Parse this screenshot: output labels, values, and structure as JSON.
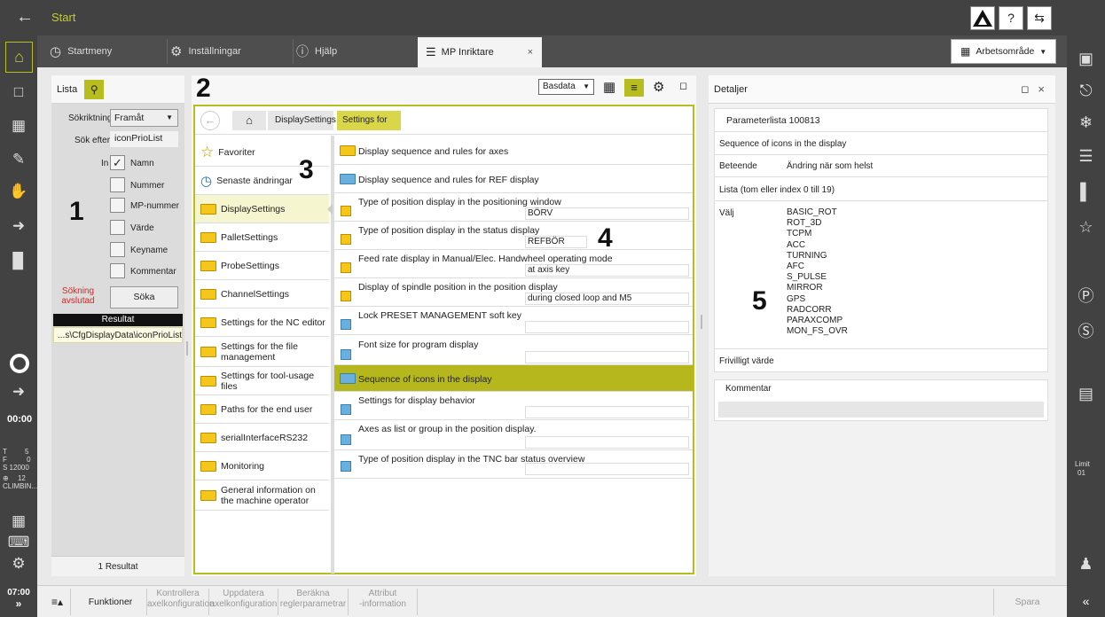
{
  "app": {
    "title": "Start",
    "time_clock": "00:00",
    "time_bottom": "07:00"
  },
  "tabs": [
    {
      "label": "Startmeny"
    },
    {
      "label": "Inställningar"
    },
    {
      "label": "Hjälp"
    },
    {
      "label": "MP Inriktare"
    }
  ],
  "workspace": {
    "label": "Arbetsområde"
  },
  "status": {
    "t": "T",
    "t_val": "5",
    "f": "F",
    "f_val": "0",
    "s": "S 12000",
    "tool_num": "12",
    "tool_name": "CLIMBIN...",
    "limit": "Limit",
    "limit_val": "01"
  },
  "list_panel": {
    "title": "Lista",
    "direction_label": "Sökriktning",
    "direction_value": "Framåt",
    "search_label": "Sök efter",
    "search_value": "iconPrioList",
    "in_label": "In",
    "checkboxes": [
      {
        "label": "Namn",
        "checked": true
      },
      {
        "label": "Nummer",
        "checked": false
      },
      {
        "label": "MP-nummer",
        "checked": false
      },
      {
        "label": "Värde",
        "checked": false
      },
      {
        "label": "Keyname",
        "checked": false
      },
      {
        "label": "Kommentar",
        "checked": false
      }
    ],
    "status_line1": "Sökning",
    "status_line2": "avslutad",
    "search_button": "Söka",
    "result_header": "Resultat",
    "result_item": "...s\\CfgDisplayData\\iconPrioList",
    "result_count": "1 Resultat"
  },
  "center": {
    "view_select": "Basdata",
    "breadcrumb": [
      "DisplaySettings",
      "Settings for sc..."
    ],
    "nav": [
      {
        "label": "Favoriter",
        "icon": "star-icon"
      },
      {
        "label": "Senaste ändringar",
        "icon": "clock-icon"
      },
      {
        "label": "DisplaySettings",
        "icon": "folder-icon"
      },
      {
        "label": "PalletSettings",
        "icon": "folder-icon"
      },
      {
        "label": "ProbeSettings",
        "icon": "folder-icon"
      },
      {
        "label": "ChannelSettings",
        "icon": "folder-icon"
      },
      {
        "label": "Settings for the NC editor",
        "icon": "folder-icon"
      },
      {
        "label": "Settings for the file management",
        "icon": "folder-icon"
      },
      {
        "label": "Settings for tool-usage files",
        "icon": "folder-icon"
      },
      {
        "label": "Paths for the end user",
        "icon": "folder-icon"
      },
      {
        "label": "serialInterfaceRS232",
        "icon": "folder-icon"
      },
      {
        "label": "Monitoring",
        "icon": "folder-icon"
      },
      {
        "label": "General information on the machine operator",
        "icon": "folder-icon"
      }
    ],
    "params": [
      {
        "label": "Display sequence and rules for axes",
        "value": ""
      },
      {
        "label": "Display sequence and rules for REF display",
        "value": ""
      },
      {
        "label": "Type of position display in the positioning window",
        "value": "BÖRV"
      },
      {
        "label": "Type of position display in the status display",
        "value": "REFBÖR"
      },
      {
        "label": "Feed rate display in Manual/Elec. Handwheel operating mode",
        "value": "at axis key"
      },
      {
        "label": "Display of spindle position in the position display",
        "value": "during closed loop and M5"
      },
      {
        "label": "Lock PRESET MANAGEMENT soft key",
        "value": ""
      },
      {
        "label": "Font size for program display",
        "value": ""
      },
      {
        "label": "Sequence of icons in the display",
        "value": ""
      },
      {
        "label": "Settings for display behavior",
        "value": ""
      },
      {
        "label": "Axes as list or group in the position display.",
        "value": ""
      },
      {
        "label": "Type of position display in the TNC bar status overview",
        "value": ""
      }
    ]
  },
  "details": {
    "title": "Detaljer",
    "param_list": "Parameterlista 100813",
    "description": "Sequence of icons in the display",
    "behavior_label": "Beteende",
    "behavior_value": "Ändring när som helst",
    "list_info": "Lista (tom eller index 0 till 19)",
    "choose_label": "Välj",
    "options": [
      "BASIC_ROT",
      "ROT_3D",
      "TCPM",
      "ACC",
      "TURNING",
      "AFC",
      "S_PULSE",
      "MIRROR",
      "GPS",
      "RADCORR",
      "PARAXCOMP",
      "MON_FS_OVR"
    ],
    "optional": "Frivilligt värde",
    "comment_label": "Kommentar"
  },
  "callouts": [
    "1",
    "2",
    "3",
    "4",
    "5"
  ],
  "bottom": {
    "functions": "Funktioner",
    "buttons": [
      {
        "l1": "Kontrollera",
        "l2": "axelkonfiguration"
      },
      {
        "l1": "Uppdatera",
        "l2": "axelkonfiguration"
      },
      {
        "l1": "Beräkna",
        "l2": "reglerparametrar"
      },
      {
        "l1": "Attribut",
        "l2": "-information"
      }
    ],
    "save": "Spara"
  },
  "colors": {
    "accent": "#b7bd1f",
    "dark": "#424242",
    "highlight": "#b5b71c"
  }
}
